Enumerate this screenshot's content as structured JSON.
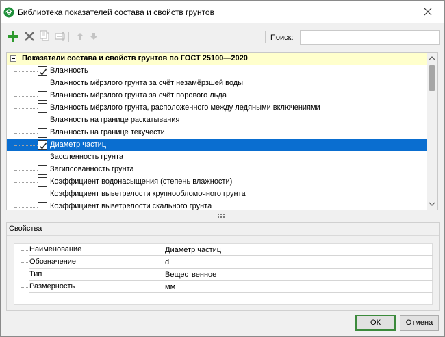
{
  "window": {
    "title": "Библиотека показателей состава и свойств грунтов"
  },
  "toolbar": {
    "add_icon": "plus-icon",
    "delete_icon": "cross-icon",
    "copy_icon": "copy-icon",
    "edit_icon": "edit-icon",
    "up_icon": "arrow-up-icon",
    "down_icon": "arrow-down-icon",
    "search_label": "Поиск:",
    "search_value": ""
  },
  "tree": {
    "root_label": "Показатели состава и свойств грунтов по ГОСТ 25100—2020",
    "items": [
      {
        "label": "Влажность",
        "checked": true,
        "selected": false
      },
      {
        "label": "Влажность мёрзлого грунта за счёт незамёрзшей воды",
        "checked": false,
        "selected": false
      },
      {
        "label": "Влажность мёрзлого грунта за счёт порового льда",
        "checked": false,
        "selected": false
      },
      {
        "label": "Влажность мёрзлого грунта, расположенного между ледяными включениями",
        "checked": false,
        "selected": false
      },
      {
        "label": "Влажность на границе раскатывания",
        "checked": false,
        "selected": false
      },
      {
        "label": "Влажность на границе текучести",
        "checked": false,
        "selected": false
      },
      {
        "label": "Диаметр частиц",
        "checked": true,
        "selected": true
      },
      {
        "label": "Засоленность грунта",
        "checked": false,
        "selected": false
      },
      {
        "label": "Загипсованность грунта",
        "checked": false,
        "selected": false
      },
      {
        "label": "Коэффициент водонасыщения (степень влажности)",
        "checked": false,
        "selected": false
      },
      {
        "label": "Коэффициент выветрелости крупнообломочного грунта",
        "checked": false,
        "selected": false
      },
      {
        "label": "Коэффициент выветрелости скального грунта",
        "checked": false,
        "selected": false
      }
    ]
  },
  "properties": {
    "title": "Свойства",
    "rows": [
      {
        "name": "Наименование",
        "value": "Диаметр частиц"
      },
      {
        "name": "Обозначение",
        "value": "d"
      },
      {
        "name": "Тип",
        "value": "Вещественное"
      },
      {
        "name": "Размерность",
        "value": "мм"
      }
    ]
  },
  "buttons": {
    "ok": "ОК",
    "cancel": "Отмена"
  },
  "colors": {
    "selection": "#0a6ed0",
    "root_highlight": "#ffffcc",
    "add_green": "#2e9a2e",
    "ok_border": "#3c8a3c"
  }
}
